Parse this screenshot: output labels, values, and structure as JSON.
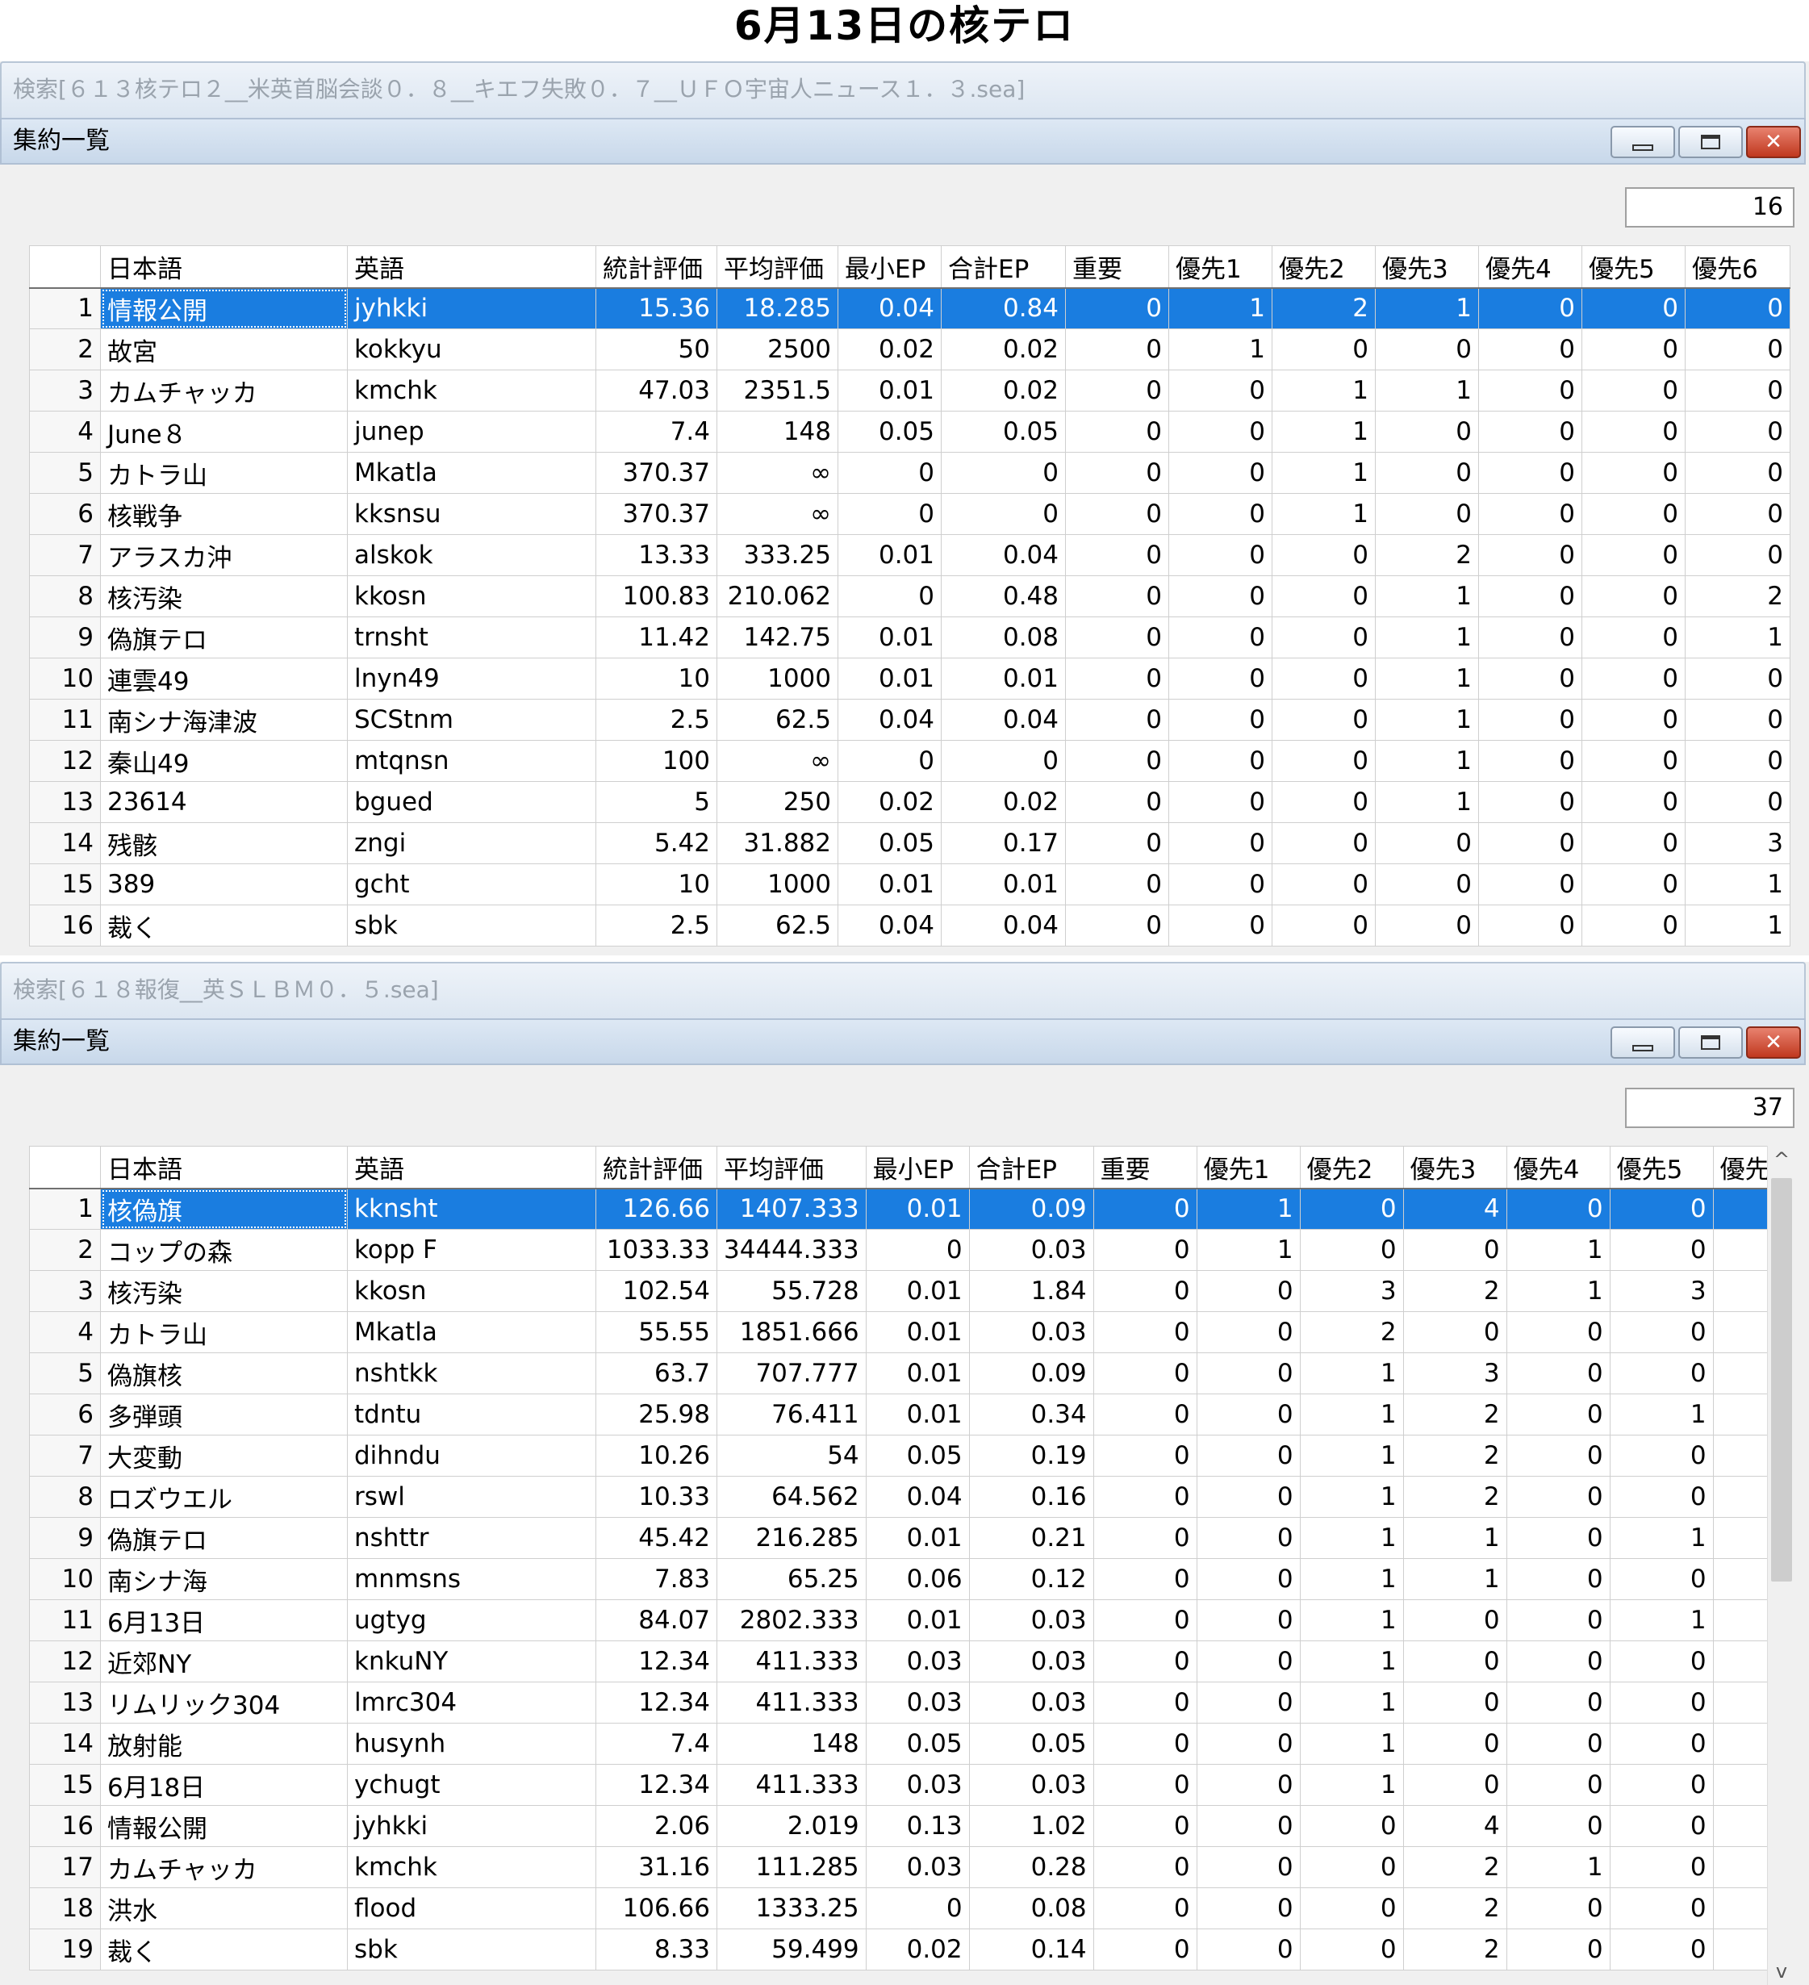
{
  "page_title": "6月13日の核テロ",
  "columns": [
    "日本語",
    "英語",
    "統計評価",
    "平均評価",
    "最小EP",
    "合計EP",
    "重要",
    "優先1",
    "優先2",
    "優先3",
    "優先4",
    "優先5"
  ],
  "panel1": {
    "search_title": "検索[６１３核テロ２__米英首脳会談０．８__キエフ失敗０．７__ＵＦＯ宇宙人ニュース１．３.sea]",
    "window_title": "集約一覧",
    "count": "16",
    "last_column": "優先6",
    "rows": [
      [
        "1",
        "情報公開",
        "jyhkki",
        "15.36",
        "18.285",
        "0.04",
        "0.84",
        "0",
        "1",
        "2",
        "1",
        "0",
        "0",
        "0"
      ],
      [
        "2",
        "故宮",
        "kokkyu",
        "50",
        "2500",
        "0.02",
        "0.02",
        "0",
        "1",
        "0",
        "0",
        "0",
        "0",
        "0"
      ],
      [
        "3",
        "カムチャッカ",
        "kmchk",
        "47.03",
        "2351.5",
        "0.01",
        "0.02",
        "0",
        "0",
        "1",
        "1",
        "0",
        "0",
        "0"
      ],
      [
        "4",
        "June８",
        "junep",
        "7.4",
        "148",
        "0.05",
        "0.05",
        "0",
        "0",
        "1",
        "0",
        "0",
        "0",
        "0"
      ],
      [
        "5",
        "カトラ山",
        "Mkatla",
        "370.37",
        "∞",
        "0",
        "0",
        "0",
        "0",
        "1",
        "0",
        "0",
        "0",
        "0"
      ],
      [
        "6",
        "核戦争",
        "kksnsu",
        "370.37",
        "∞",
        "0",
        "0",
        "0",
        "0",
        "1",
        "0",
        "0",
        "0",
        "0"
      ],
      [
        "7",
        "アラスカ沖",
        "alskok",
        "13.33",
        "333.25",
        "0.01",
        "0.04",
        "0",
        "0",
        "0",
        "2",
        "0",
        "0",
        "0"
      ],
      [
        "8",
        "核汚染",
        "kkosn",
        "100.83",
        "210.062",
        "0",
        "0.48",
        "0",
        "0",
        "0",
        "1",
        "0",
        "0",
        "2"
      ],
      [
        "9",
        "偽旗テロ",
        "trnsht",
        "11.42",
        "142.75",
        "0.01",
        "0.08",
        "0",
        "0",
        "0",
        "1",
        "0",
        "0",
        "1"
      ],
      [
        "10",
        "連雲49",
        "lnyn49",
        "10",
        "1000",
        "0.01",
        "0.01",
        "0",
        "0",
        "0",
        "1",
        "0",
        "0",
        "0"
      ],
      [
        "11",
        "南シナ海津波",
        "SCStnm",
        "2.5",
        "62.5",
        "0.04",
        "0.04",
        "0",
        "0",
        "0",
        "1",
        "0",
        "0",
        "0"
      ],
      [
        "12",
        "秦山49",
        "mtqnsn",
        "100",
        "∞",
        "0",
        "0",
        "0",
        "0",
        "0",
        "1",
        "0",
        "0",
        "0"
      ],
      [
        "13",
        "23614",
        "bgued",
        "5",
        "250",
        "0.02",
        "0.02",
        "0",
        "0",
        "0",
        "1",
        "0",
        "0",
        "0"
      ],
      [
        "14",
        "残骸",
        "zngi",
        "5.42",
        "31.882",
        "0.05",
        "0.17",
        "0",
        "0",
        "0",
        "0",
        "0",
        "0",
        "3"
      ],
      [
        "15",
        "389",
        "gcht",
        "10",
        "1000",
        "0.01",
        "0.01",
        "0",
        "0",
        "0",
        "0",
        "0",
        "0",
        "1"
      ],
      [
        "16",
        "裁く",
        "sbk",
        "2.5",
        "62.5",
        "0.04",
        "0.04",
        "0",
        "0",
        "0",
        "0",
        "0",
        "0",
        "1"
      ]
    ]
  },
  "panel2": {
    "search_title": "検索[６１８報復__英ＳＬＢＭ０．５.sea]",
    "window_title": "集約一覧",
    "count": "37",
    "last_column": "優先",
    "rows": [
      [
        "1",
        "核偽旗",
        "kknsht",
        "126.66",
        "1407.333",
        "0.01",
        "0.09",
        "0",
        "1",
        "0",
        "4",
        "0",
        "0",
        ""
      ],
      [
        "2",
        "コップの森",
        "kopp F",
        "1033.33",
        "34444.333",
        "0",
        "0.03",
        "0",
        "1",
        "0",
        "0",
        "1",
        "0",
        ""
      ],
      [
        "3",
        "核汚染",
        "kkosn",
        "102.54",
        "55.728",
        "0.01",
        "1.84",
        "0",
        "0",
        "3",
        "2",
        "1",
        "3",
        ""
      ],
      [
        "4",
        "カトラ山",
        "Mkatla",
        "55.55",
        "1851.666",
        "0.01",
        "0.03",
        "0",
        "0",
        "2",
        "0",
        "0",
        "0",
        ""
      ],
      [
        "5",
        "偽旗核",
        "nshtkk",
        "63.7",
        "707.777",
        "0.01",
        "0.09",
        "0",
        "0",
        "1",
        "3",
        "0",
        "0",
        ""
      ],
      [
        "6",
        "多弾頭",
        "tdntu",
        "25.98",
        "76.411",
        "0.01",
        "0.34",
        "0",
        "0",
        "1",
        "2",
        "0",
        "1",
        ""
      ],
      [
        "7",
        "大変動",
        "dihndu",
        "10.26",
        "54",
        "0.05",
        "0.19",
        "0",
        "0",
        "1",
        "2",
        "0",
        "0",
        ""
      ],
      [
        "8",
        "ロズウエル",
        "rswl",
        "10.33",
        "64.562",
        "0.04",
        "0.16",
        "0",
        "0",
        "1",
        "2",
        "0",
        "0",
        ""
      ],
      [
        "9",
        "偽旗テロ",
        "nshttr",
        "45.42",
        "216.285",
        "0.01",
        "0.21",
        "0",
        "0",
        "1",
        "1",
        "0",
        "1",
        ""
      ],
      [
        "10",
        "南シナ海",
        "mnmsns",
        "7.83",
        "65.25",
        "0.06",
        "0.12",
        "0",
        "0",
        "1",
        "1",
        "0",
        "0",
        ""
      ],
      [
        "11",
        "6月13日",
        "ugtyg",
        "84.07",
        "2802.333",
        "0.01",
        "0.03",
        "0",
        "0",
        "1",
        "0",
        "0",
        "1",
        ""
      ],
      [
        "12",
        "近郊NY",
        "knkuNY",
        "12.34",
        "411.333",
        "0.03",
        "0.03",
        "0",
        "0",
        "1",
        "0",
        "0",
        "0",
        ""
      ],
      [
        "13",
        "リムリック304",
        "lmrc304",
        "12.34",
        "411.333",
        "0.03",
        "0.03",
        "0",
        "0",
        "1",
        "0",
        "0",
        "0",
        ""
      ],
      [
        "14",
        "放射能",
        "husynh",
        "7.4",
        "148",
        "0.05",
        "0.05",
        "0",
        "0",
        "1",
        "0",
        "0",
        "0",
        ""
      ],
      [
        "15",
        "6月18日",
        "ychugt",
        "12.34",
        "411.333",
        "0.03",
        "0.03",
        "0",
        "0",
        "1",
        "0",
        "0",
        "0",
        ""
      ],
      [
        "16",
        "情報公開",
        "jyhkki",
        "2.06",
        "2.019",
        "0.13",
        "1.02",
        "0",
        "0",
        "0",
        "4",
        "0",
        "0",
        ""
      ],
      [
        "17",
        "カムチャッカ",
        "kmchk",
        "31.16",
        "111.285",
        "0.03",
        "0.28",
        "0",
        "0",
        "0",
        "2",
        "1",
        "0",
        ""
      ],
      [
        "18",
        "洪水",
        "flood",
        "106.66",
        "1333.25",
        "0",
        "0.08",
        "0",
        "0",
        "0",
        "2",
        "0",
        "0",
        ""
      ],
      [
        "19",
        "裁く",
        "sbk",
        "8.33",
        "59.499",
        "0.02",
        "0.14",
        "0",
        "0",
        "0",
        "2",
        "0",
        "0",
        ""
      ]
    ]
  }
}
